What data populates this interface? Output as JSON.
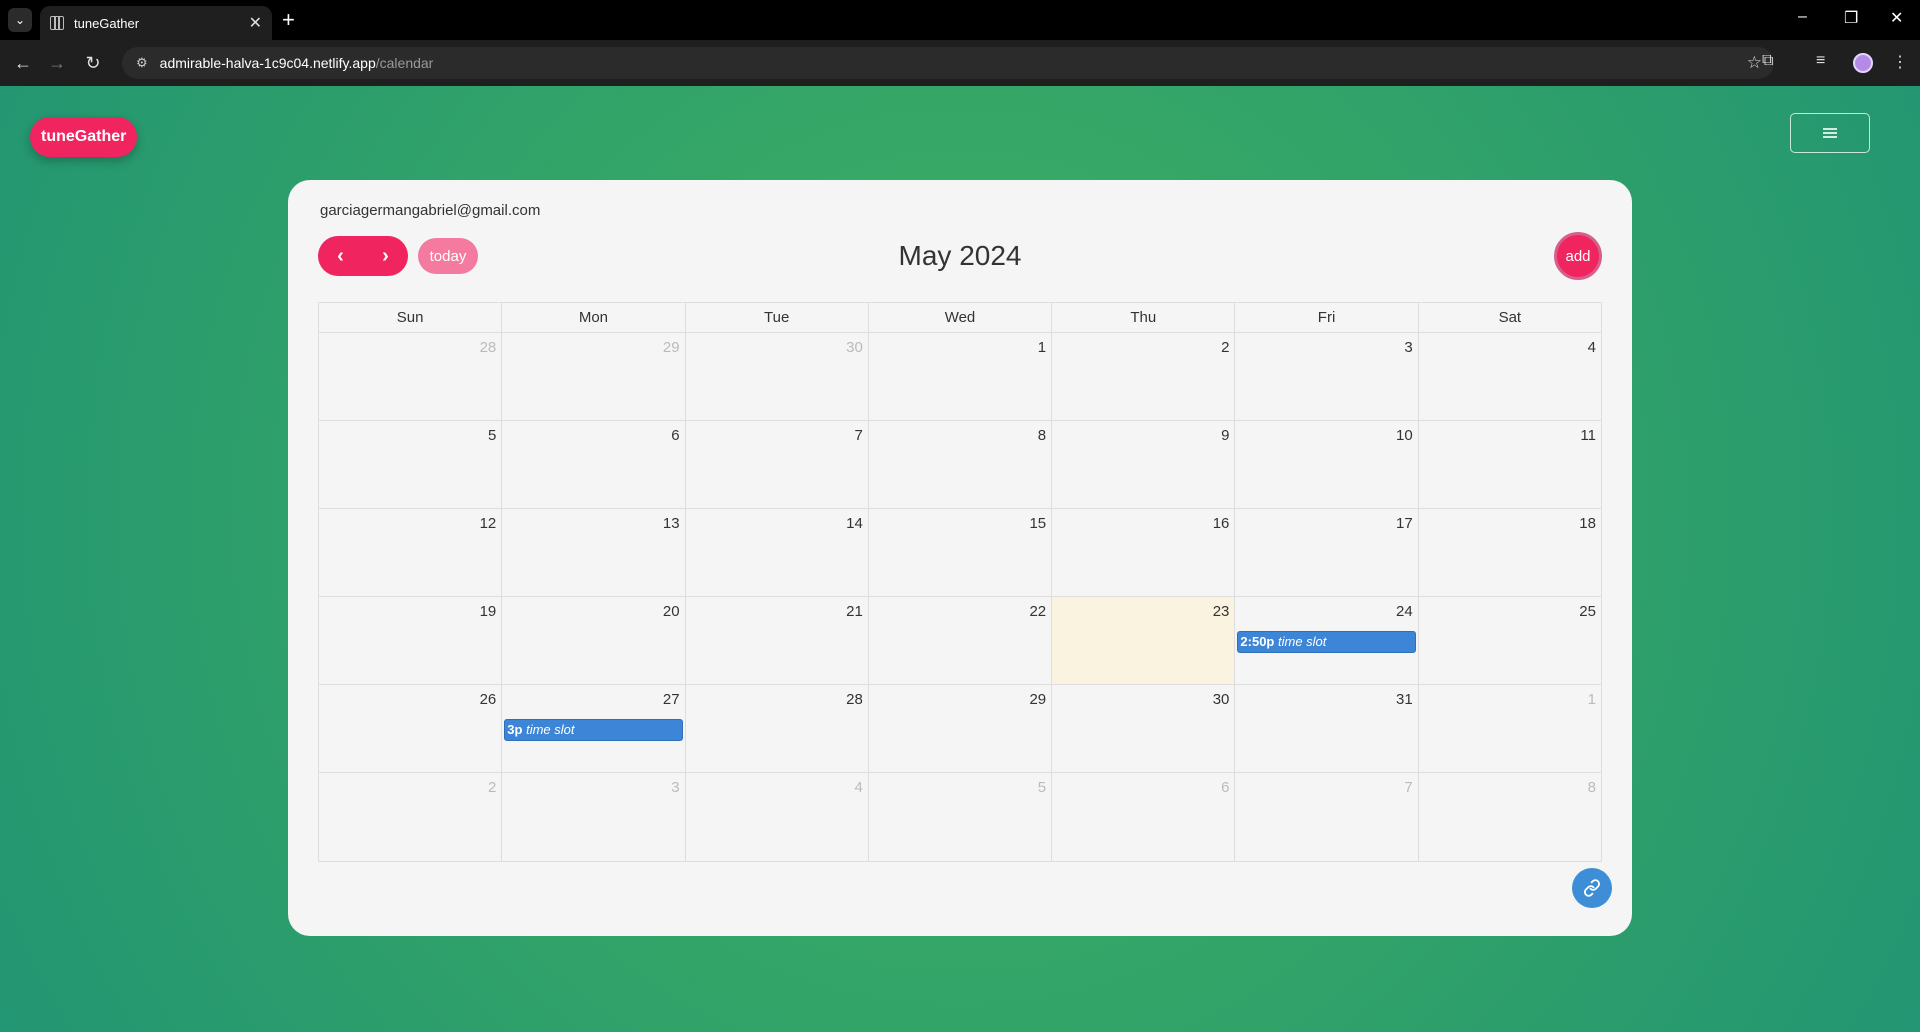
{
  "browser": {
    "tab_title": "tuneGather",
    "url_host": "admirable-halva-1c9c04.netlify.app",
    "url_path": "/calendar"
  },
  "header": {
    "brand": "tuneGather"
  },
  "calendar": {
    "user_email": "garciagermangabriel@gmail.com",
    "title": "May 2024",
    "today_label": "today",
    "add_label": "add",
    "days_of_week": [
      "Sun",
      "Mon",
      "Tue",
      "Wed",
      "Thu",
      "Fri",
      "Sat"
    ],
    "weeks": [
      [
        {
          "n": "28",
          "other": true
        },
        {
          "n": "29",
          "other": true
        },
        {
          "n": "30",
          "other": true
        },
        {
          "n": "1"
        },
        {
          "n": "2"
        },
        {
          "n": "3"
        },
        {
          "n": "4"
        }
      ],
      [
        {
          "n": "5"
        },
        {
          "n": "6"
        },
        {
          "n": "7"
        },
        {
          "n": "8"
        },
        {
          "n": "9"
        },
        {
          "n": "10"
        },
        {
          "n": "11"
        }
      ],
      [
        {
          "n": "12"
        },
        {
          "n": "13"
        },
        {
          "n": "14"
        },
        {
          "n": "15"
        },
        {
          "n": "16"
        },
        {
          "n": "17"
        },
        {
          "n": "18"
        }
      ],
      [
        {
          "n": "19"
        },
        {
          "n": "20"
        },
        {
          "n": "21"
        },
        {
          "n": "22"
        },
        {
          "n": "23",
          "today": true
        },
        {
          "n": "24",
          "event": {
            "time": "2:50p",
            "title": "time slot"
          }
        },
        {
          "n": "25"
        }
      ],
      [
        {
          "n": "26"
        },
        {
          "n": "27",
          "event": {
            "time": "3p",
            "title": "time slot"
          }
        },
        {
          "n": "28"
        },
        {
          "n": "29"
        },
        {
          "n": "30"
        },
        {
          "n": "31"
        },
        {
          "n": "1",
          "other": true
        }
      ],
      [
        {
          "n": "2",
          "other": true
        },
        {
          "n": "3",
          "other": true
        },
        {
          "n": "4",
          "other": true
        },
        {
          "n": "5",
          "other": true
        },
        {
          "n": "6",
          "other": true
        },
        {
          "n": "7",
          "other": true
        },
        {
          "n": "8",
          "other": true
        }
      ]
    ]
  },
  "colors": {
    "accent": "#f0245f",
    "event": "#3d85d6",
    "today_bg": "#f9f3df"
  }
}
